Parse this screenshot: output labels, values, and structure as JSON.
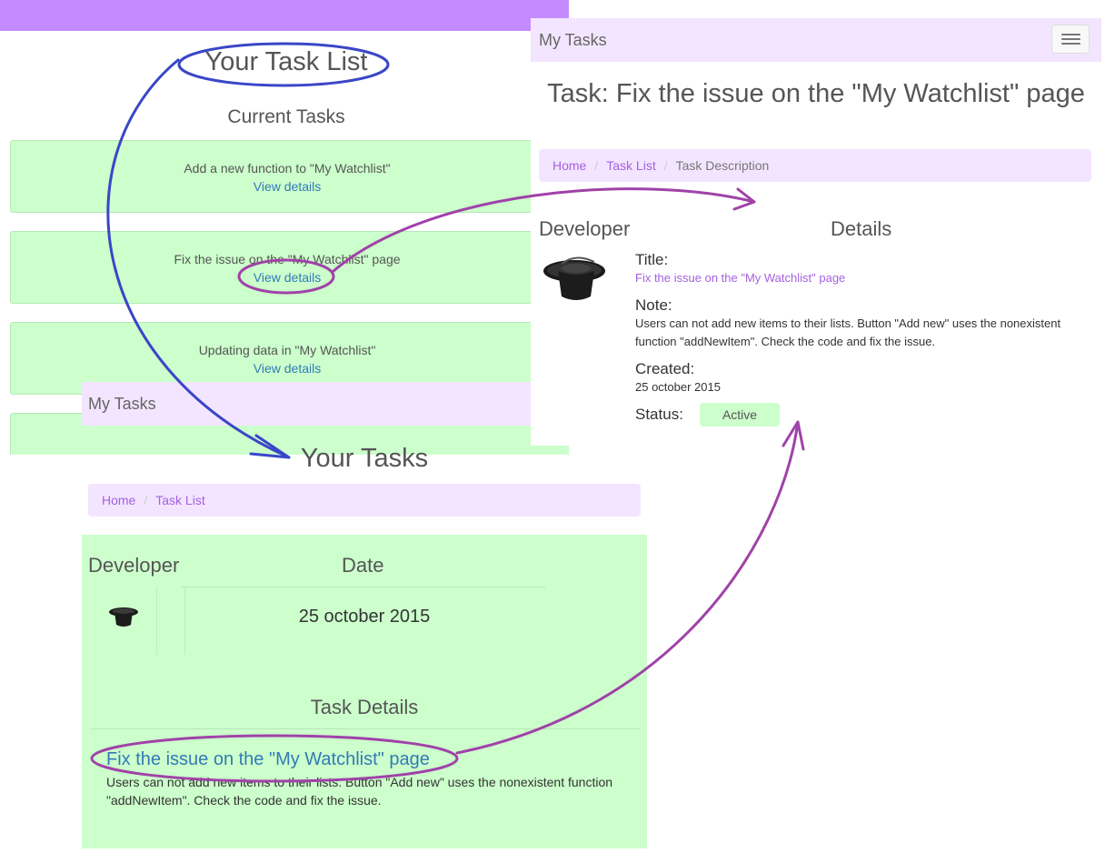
{
  "task_list": {
    "title": "Your Task List",
    "subtitle": "Current Tasks",
    "tasks": [
      {
        "title": "Add a new function to \"My Watchlist\"",
        "link": "View details"
      },
      {
        "title": "Fix the issue on the \"My Watchlist\" page",
        "link": "View details"
      },
      {
        "title": "Updating data in \"My Watchlist\"",
        "link": "View details"
      }
    ]
  },
  "task_detail": {
    "brand": "My Tasks",
    "page_title": "Task: Fix the issue on the \"My Watchlist\" page",
    "breadcrumb": {
      "home": "Home",
      "list": "Task List",
      "current": "Task Description"
    },
    "developer_heading": "Developer",
    "details_heading": "Details",
    "title_label": "Title:",
    "title_value": "Fix the issue on the \"My Watchlist\" page",
    "note_label": "Note:",
    "note_value": "Users can not add new items to their lists. Button \"Add new\" uses the nonexistent function \"addNewItem\". Check the code and fix the issue.",
    "created_label": "Created:",
    "created_value": "25 october 2015",
    "status_label": "Status:",
    "status_value": "Active"
  },
  "your_tasks": {
    "brand": "My Tasks",
    "title": "Your Tasks",
    "breadcrumb": {
      "home": "Home",
      "list": "Task List"
    },
    "col_developer": "Developer",
    "col_date": "Date",
    "date": "25 october 2015",
    "details_heading": "Task Details",
    "task_title": "Fix the issue on the \"My Watchlist\" page",
    "task_description": "Users can not add new items to their lists. Button \"Add new\" uses the nonexistent function \"addNewItem\". Check the code and fix the issue."
  },
  "colors": {
    "top_bar": "#c48bff",
    "navbar": "#f3e5ff",
    "card_green": "#ccffcc",
    "link_blue": "#337ab7",
    "link_purple": "#a561e0",
    "annotation_blue": "#3a46c8",
    "annotation_purple": "#a042a8"
  },
  "icons": [
    "top-hat-icon",
    "hamburger-menu-icon"
  ]
}
